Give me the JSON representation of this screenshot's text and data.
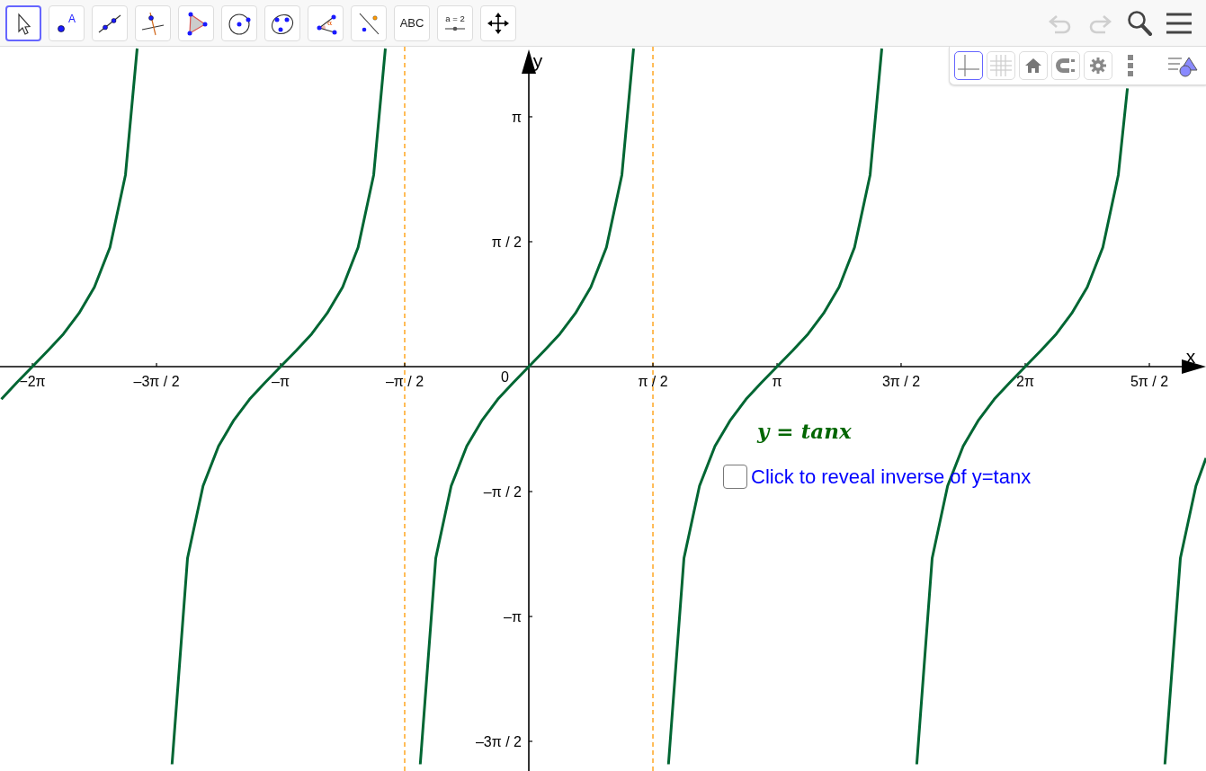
{
  "toolbar": {
    "tools": [
      {
        "kind": "pointer",
        "selected": true
      },
      {
        "kind": "point",
        "label": "A",
        "selected": false
      },
      {
        "kind": "line",
        "selected": false
      },
      {
        "kind": "perpendicular",
        "selected": false
      },
      {
        "kind": "polygon",
        "selected": false
      },
      {
        "kind": "circle",
        "selected": false
      },
      {
        "kind": "conic",
        "selected": false
      },
      {
        "kind": "angle",
        "label": "α",
        "selected": false
      },
      {
        "kind": "reflect",
        "selected": false
      },
      {
        "kind": "text",
        "label": "ABC",
        "selected": false
      },
      {
        "kind": "slider",
        "label": "a = 2",
        "selected": false
      },
      {
        "kind": "pan",
        "selected": false
      }
    ],
    "actions": [
      {
        "kind": "undo",
        "disabled": true
      },
      {
        "kind": "redo",
        "disabled": true
      },
      {
        "kind": "search",
        "disabled": false
      },
      {
        "kind": "menu",
        "disabled": false
      }
    ]
  },
  "style_bar": {
    "buttons": [
      {
        "kind": "axes",
        "selected": true
      },
      {
        "kind": "grid",
        "selected": false
      },
      {
        "kind": "home",
        "selected": false
      },
      {
        "kind": "magnet",
        "selected": false
      },
      {
        "kind": "settings",
        "selected": false
      },
      {
        "kind": "more"
      },
      {
        "kind": "toggle"
      }
    ]
  },
  "graph": {
    "chart_data": {
      "type": "line",
      "xlabel": "x",
      "ylabel": "y",
      "xlim": [
        -6.693,
        8.571
      ],
      "ylim": [
        -5.085,
        4.023
      ],
      "xticks": [
        {
          "value": -6.283,
          "label": "−2π"
        },
        {
          "value": -4.712,
          "label": "–3π / 2"
        },
        {
          "value": -3.142,
          "label": "–π"
        },
        {
          "value": -1.571,
          "label": "–π / 2"
        },
        {
          "value": 1.571,
          "label": "π / 2"
        },
        {
          "value": 3.142,
          "label": "π"
        },
        {
          "value": 4.712,
          "label": "3π / 2"
        },
        {
          "value": 6.283,
          "label": "2π"
        },
        {
          "value": 7.854,
          "label": "5π / 2"
        }
      ],
      "yticks": [
        {
          "value": 3.142,
          "label": "π"
        },
        {
          "value": 1.571,
          "label": "π / 2"
        },
        {
          "value": -1.571,
          "label": "–π / 2"
        },
        {
          "value": -3.142,
          "label": "–π"
        },
        {
          "value": -4.712,
          "label": "–3π / 2"
        }
      ],
      "x": [
        -6.676,
        -6.48,
        -6.283,
        -6.087,
        -5.89,
        -5.694,
        -5.498,
        -5.301,
        -5.105,
        -4.957,
        -4.516,
        -4.32,
        -4.123,
        -3.927,
        -3.731,
        -3.534,
        -3.338,
        -3.142,
        -2.945,
        -2.749,
        -2.553,
        -2.356,
        -2.16,
        -1.963,
        -1.816,
        -1.374,
        -1.178,
        -0.982,
        -0.785,
        -0.589,
        -0.393,
        -0.196,
        0,
        0.196,
        0.393,
        0.589,
        0.785,
        0.982,
        1.178,
        1.326,
        1.768,
        1.963,
        2.16,
        2.356,
        2.553,
        2.749,
        2.945,
        3.142,
        3.338,
        3.534,
        3.731,
        3.927,
        4.123,
        4.32,
        4.468,
        4.91,
        5.105,
        5.301,
        5.498,
        5.694,
        5.89,
        6.087,
        6.283,
        6.48,
        6.676,
        6.872,
        7.069,
        7.265,
        7.461,
        7.576,
        8.051,
        8.247,
        8.443,
        8.571
      ],
      "series": [
        {
          "name": "y = tanx",
          "color": "#006633",
          "values": [
            -0.41,
            -0.2,
            0,
            0.2,
            0.41,
            0.67,
            1,
            1.5,
            2.41,
            4,
            -5,
            -2.41,
            -1.5,
            -1,
            -0.67,
            -0.41,
            -0.2,
            0,
            0.2,
            0.41,
            0.67,
            1,
            1.5,
            2.41,
            4,
            -5,
            -2.41,
            -1.5,
            -1,
            -0.67,
            -0.41,
            -0.2,
            0,
            0.2,
            0.41,
            0.67,
            1,
            1.5,
            2.41,
            4,
            -5,
            -2.41,
            -1.5,
            -1,
            -0.67,
            -0.41,
            -0.2,
            0,
            0.2,
            0.41,
            0.67,
            1,
            1.5,
            2.41,
            4,
            -5,
            -2.41,
            -1.5,
            -1,
            -0.67,
            -0.41,
            -0.2,
            0,
            0.2,
            0.41,
            0.67,
            1,
            1.5,
            2.41,
            3.5,
            -5,
            -2.41,
            -1.5,
            -1.15
          ]
        }
      ],
      "ref_lines": [
        {
          "axis": "x",
          "value": -1.571
        },
        {
          "axis": "x",
          "value": 1.571
        }
      ]
    },
    "origin_label": "0",
    "checkbox": {
      "label": "Click to reveal inverse of y=tanx",
      "checked": false
    }
  }
}
